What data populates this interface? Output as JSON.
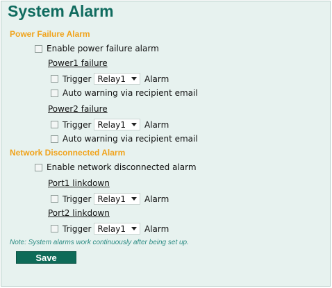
{
  "page": {
    "title": "System Alarm"
  },
  "power": {
    "section_title": "Power Failure Alarm",
    "enable_label": "Enable power failure alarm",
    "power1": {
      "title": "Power1 failure",
      "trigger_label": "Trigger",
      "relay_selected": "Relay1",
      "alarm_label": "Alarm",
      "email_label": "Auto warning via recipient email"
    },
    "power2": {
      "title": "Power2 failure",
      "trigger_label": "Trigger",
      "relay_selected": "Relay1",
      "alarm_label": "Alarm",
      "email_label": "Auto warning via recipient email"
    }
  },
  "network": {
    "section_title": "Network Disconnected Alarm",
    "enable_label": "Enable network disconnected alarm",
    "port1": {
      "title": "Port1 linkdown",
      "trigger_label": "Trigger",
      "relay_selected": "Relay1",
      "alarm_label": "Alarm"
    },
    "port2": {
      "title": "Port2 linkdown",
      "trigger_label": "Trigger",
      "relay_selected": "Relay1",
      "alarm_label": "Alarm"
    }
  },
  "note": "Note: System alarms work continuously after being set up.",
  "save_label": "Save"
}
